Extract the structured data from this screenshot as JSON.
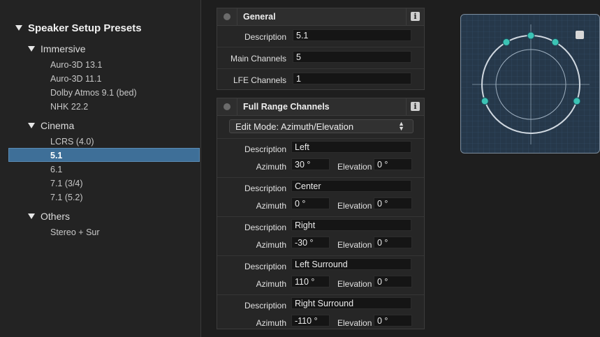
{
  "tree": {
    "root_label": "Speaker Setup Presets",
    "groups": [
      {
        "label": "Immersive",
        "items": [
          "Auro-3D 13.1",
          "Auro-3D 11.1",
          "Dolby Atmos 9.1 (bed)",
          "NHK 22.2"
        ]
      },
      {
        "label": "Cinema",
        "items": [
          "LCRS (4.0)",
          "5.1",
          "6.1",
          "7.1 (3/4)",
          "7.1 (5.2)"
        ]
      },
      {
        "label": "Others",
        "items": [
          "Stereo + Sur"
        ]
      }
    ],
    "selected": "5.1"
  },
  "general": {
    "title": "General",
    "info_icon": "i",
    "fields": [
      {
        "label": "Description",
        "value": "5.1"
      },
      {
        "label": "Main Channels",
        "value": "5"
      },
      {
        "label": "LFE Channels",
        "value": "1"
      }
    ]
  },
  "full_range": {
    "title": "Full Range Channels",
    "info_icon": "i",
    "edit_mode": "Edit Mode: Azimuth/Elevation",
    "desc_label": "Description",
    "az_label": "Azimuth",
    "el_label": "Elevation",
    "channels": [
      {
        "description": "Left",
        "azimuth": "30 °",
        "elevation": "0 °"
      },
      {
        "description": "Center",
        "azimuth": "0 °",
        "elevation": "0 °"
      },
      {
        "description": "Right",
        "azimuth": "-30 °",
        "elevation": "0 °"
      },
      {
        "description": "Left Surround",
        "azimuth": "110 °",
        "elevation": "0 °"
      },
      {
        "description": "Right Surround",
        "azimuth": "-110 °",
        "elevation": "0 °"
      }
    ]
  },
  "speaker_view": {
    "speaker_azimuths": [
      30,
      0,
      -30,
      110,
      -110
    ],
    "accent": "#3cc3b5"
  }
}
